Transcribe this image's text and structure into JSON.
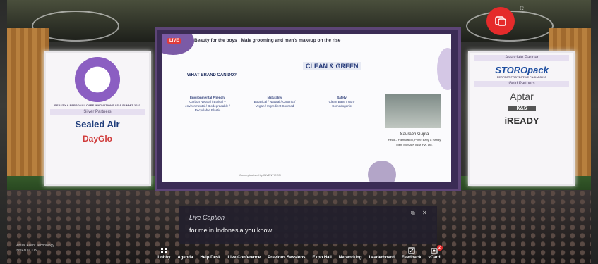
{
  "stage": {
    "live_label": "LIVE",
    "slide_title": "Beauty for the boys : Male grooming and men's makeup on the rise",
    "slide_heading": "CLEAN & GREEN",
    "slide_question": "WHAT BRAND CAN DO?",
    "columns": [
      {
        "title": "Environmental Friendly",
        "body": "Carbon Neutral / Ethical – environmental / Biodegradable / Recyclable Plastic"
      },
      {
        "title": "Naturality",
        "body": "Botanical / Natural / Organic / Vegan / Ingredient Sourced"
      },
      {
        "title": "Safety",
        "body": "Clean Base / Non-Comedogenic"
      }
    ],
    "speaker_name": "Saurabh Gupta",
    "speaker_role": "Head – Formulation, Prime Baby & Handy Men, MOSAIK India Pvt. Ltd.",
    "sponsored_by": "Conceptualised by INVENTICON"
  },
  "left_panel": {
    "summit_title": "BEAUTY & PERSONAL CARE INNOVATIONS ASIA SUMMIT 2023",
    "partners_caption": "Silver Partners",
    "sponsors": [
      "Sealed Air",
      "DayGlo"
    ]
  },
  "right_panel": {
    "associate_caption": "Associate Partner",
    "associate_sponsor": "STOROpack",
    "associate_tagline": "PERFECT PROTECTIVE PACKAGING",
    "gold_caption": "Gold Partners",
    "gold_sponsors": [
      "Aptar",
      "K&S",
      "iREADY"
    ]
  },
  "live_caption": {
    "label": "Live Caption",
    "text": "for me in Indonesia you know"
  },
  "nav": {
    "items": [
      {
        "label": "Lobby"
      },
      {
        "label": "Agenda"
      },
      {
        "label": "Help Desk"
      },
      {
        "label": "Live Conference"
      },
      {
        "label": "Previous Sessions"
      },
      {
        "label": "Expo Hall"
      },
      {
        "label": "Networking"
      },
      {
        "label": "Leaderboard"
      },
      {
        "label": "Feedback"
      },
      {
        "label": "vCard"
      }
    ],
    "vcard_badge": "2"
  },
  "footer_logo": "Virtual Event Technology INVENTICON",
  "colors": {
    "record_button": "#e52b2b",
    "accent": "#7b5aa6"
  }
}
